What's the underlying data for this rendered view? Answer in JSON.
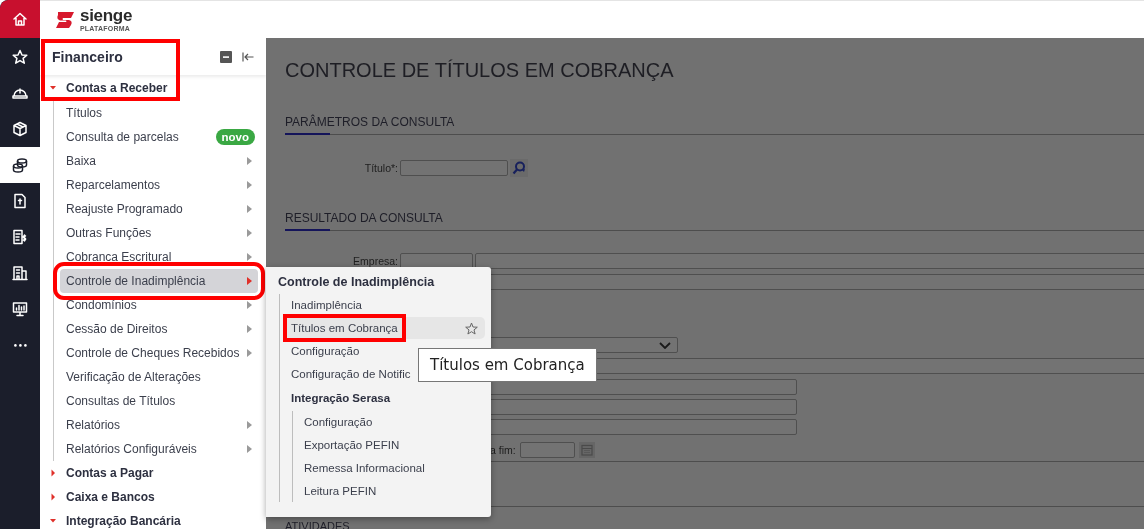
{
  "rail": [
    {
      "kind": "home",
      "selected": false
    },
    {
      "kind": "item",
      "selected": false
    },
    {
      "kind": "item",
      "selected": false
    },
    {
      "kind": "item",
      "selected": false
    },
    {
      "kind": "item",
      "selected": true
    },
    {
      "kind": "item",
      "selected": false
    },
    {
      "kind": "item",
      "selected": false
    },
    {
      "kind": "item",
      "selected": false
    },
    {
      "kind": "item",
      "selected": false
    },
    {
      "kind": "item",
      "selected": false
    }
  ],
  "header": {
    "logo": "sienge",
    "logo_subtitle": "PLATAFORMA"
  },
  "sidebar": {
    "title": "Financeiro",
    "highlighted": true,
    "groups": [
      {
        "label": "Contas a Receber",
        "expanded": true,
        "items": [
          {
            "label": "Títulos",
            "submenu": false,
            "selected": false,
            "highlighted": false
          },
          {
            "label": "Consulta de parcelas",
            "submenu": false,
            "selected": false,
            "highlighted": false,
            "badge": "novo"
          },
          {
            "label": "Baixa",
            "submenu": true,
            "selected": false,
            "highlighted": false
          },
          {
            "label": "Reparcelamentos",
            "submenu": true,
            "selected": false,
            "highlighted": false
          },
          {
            "label": "Reajuste Programado",
            "submenu": true,
            "selected": false,
            "highlighted": false
          },
          {
            "label": "Outras Funções",
            "submenu": true,
            "selected": false,
            "highlighted": false
          },
          {
            "label": "Cobranca Escritural",
            "submenu": true,
            "selected": false,
            "highlighted": false
          },
          {
            "label": "Controle de Inadimplência",
            "submenu": true,
            "selected": true,
            "highlighted": true
          },
          {
            "label": "Condomínios",
            "submenu": true,
            "selected": false,
            "highlighted": false
          },
          {
            "label": "Cessão de Direitos",
            "submenu": true,
            "selected": false,
            "highlighted": false
          },
          {
            "label": "Controle de Cheques Recebidos",
            "submenu": true,
            "selected": false,
            "highlighted": false
          },
          {
            "label": "Verificação de Alterações",
            "submenu": false,
            "selected": false,
            "highlighted": false
          },
          {
            "label": "Consultas de Títulos",
            "submenu": false,
            "selected": false,
            "highlighted": false
          },
          {
            "label": "Relatórios",
            "submenu": true,
            "selected": false,
            "highlighted": false
          },
          {
            "label": "Relatórios Configuráveis",
            "submenu": true,
            "selected": false,
            "highlighted": false
          }
        ]
      },
      {
        "label": "Contas a Pagar",
        "expanded": false
      },
      {
        "label": "Caixa e Bancos",
        "expanded": false
      },
      {
        "label": "Integração Bancária",
        "expanded": true
      }
    ]
  },
  "page": {
    "title": "CONTROLE DE TÍTULOS EM COBRANÇA",
    "query_heading": "PARÂMETROS DA CONSULTA",
    "title_label": "Título*:",
    "result_heading": "RESULTADO DA CONSULTA",
    "company_label": "Empresa:",
    "end_date_label": "a fim:",
    "activities_heading": "ATIVIDADES"
  },
  "flyout": {
    "title": "Controle de Inadimplência",
    "items": [
      {
        "kind": "link",
        "label": "Inadimplência",
        "hovered": false
      },
      {
        "kind": "link",
        "label": "Títulos em Cobrança",
        "hovered": true,
        "highlighted": true
      },
      {
        "kind": "link",
        "label": "Configuração",
        "hovered": false
      },
      {
        "kind": "link",
        "label": "Configuração de Notific",
        "hovered": false
      },
      {
        "kind": "group",
        "label": "Integração Serasa",
        "children": [
          {
            "kind": "link",
            "label": "Configuração",
            "hovered": false
          },
          {
            "kind": "link",
            "label": "Exportação PEFIN",
            "hovered": false
          },
          {
            "kind": "link",
            "label": "Remessa Informacional",
            "hovered": false
          },
          {
            "kind": "link",
            "label": "Leitura PEFIN",
            "hovered": false
          }
        ]
      }
    ]
  },
  "tooltip": {
    "text": "Títulos em Cobrança"
  }
}
